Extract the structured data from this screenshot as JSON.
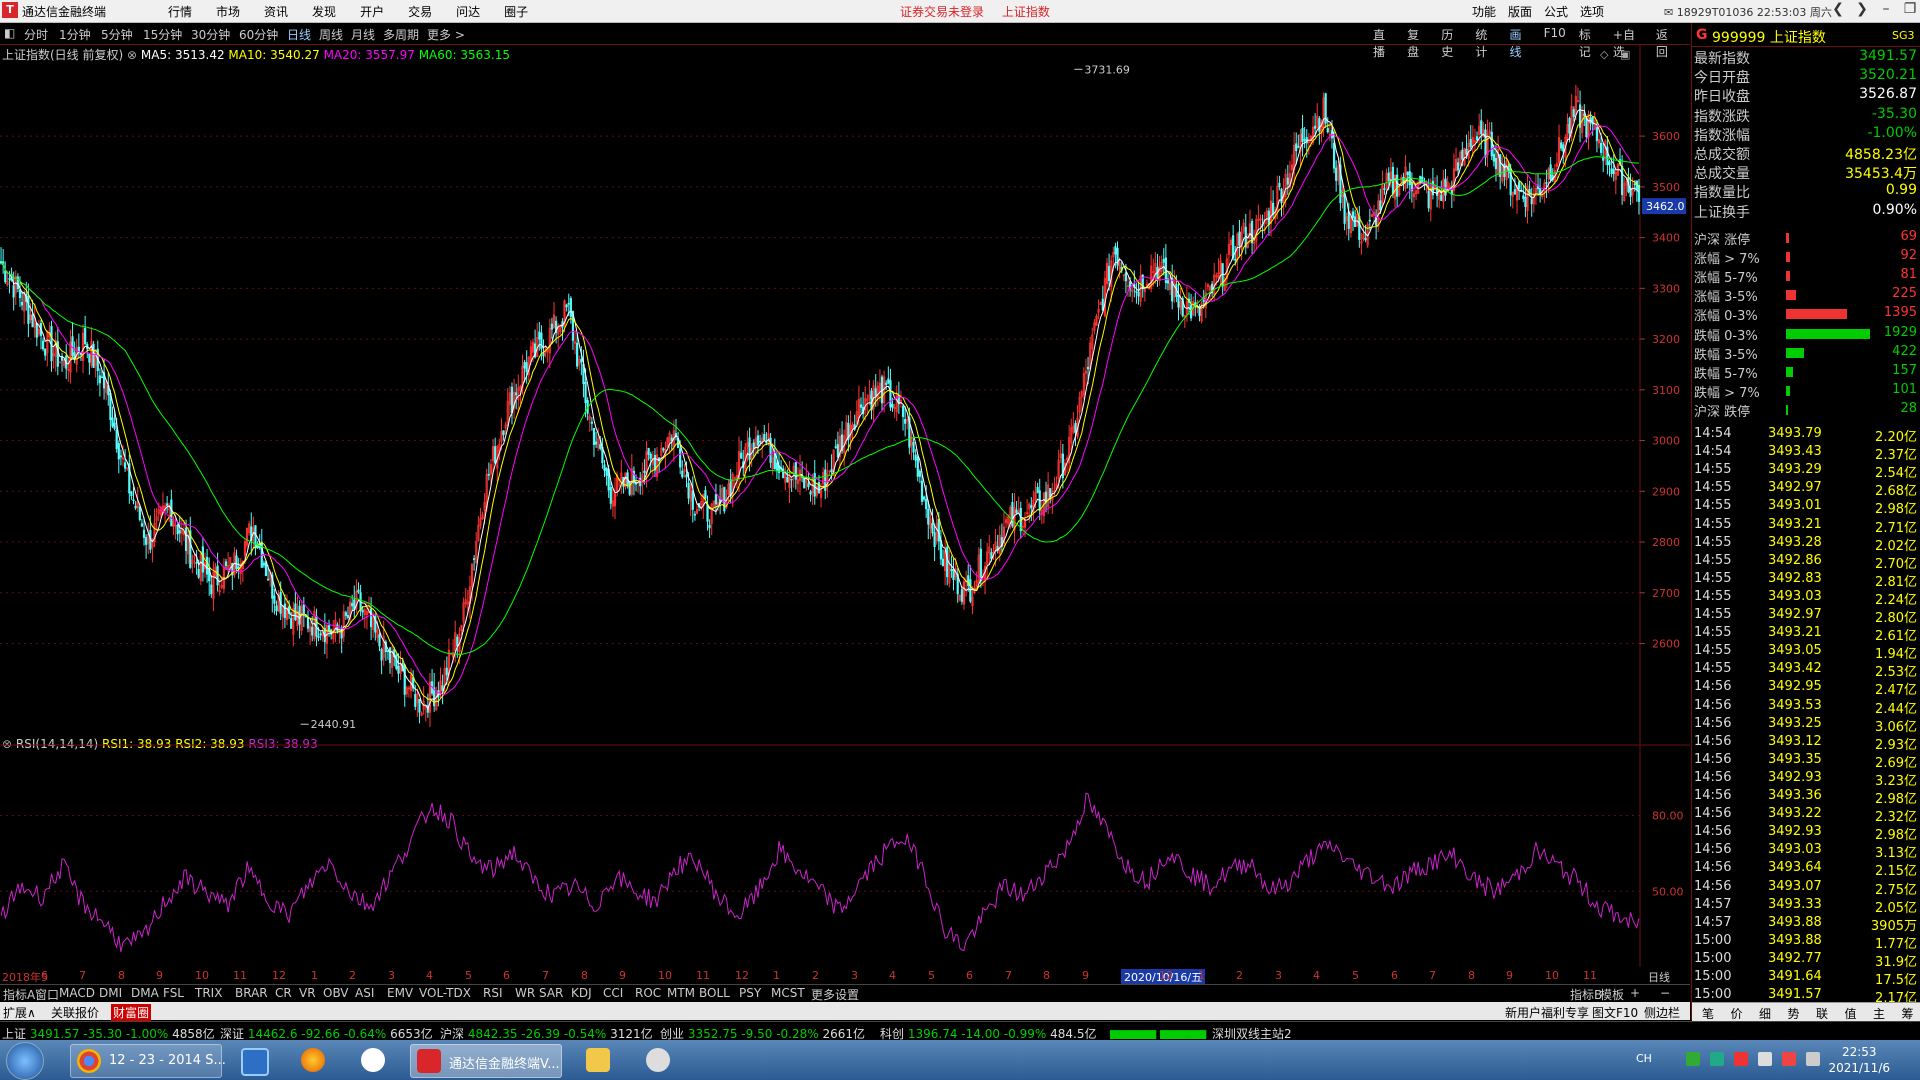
{
  "titlebar": {
    "app_title": "通达信金融终端",
    "logo": "T",
    "menu": [
      "行情",
      "市场",
      "资讯",
      "发现",
      "开户",
      "交易",
      "问达",
      "圈子"
    ],
    "center": [
      "证券交易未登录",
      "上证指数"
    ],
    "right_menu": [
      "功能",
      "版面",
      "公式",
      "选项"
    ],
    "account": "18929T01036 22:53:03 周六",
    "icons": [
      "mail-icon",
      "back-icon",
      "forward-icon",
      "minimize-icon",
      "restore-icon",
      "close-icon"
    ]
  },
  "periods": [
    {
      "label": "分时",
      "active": false
    },
    {
      "label": "1分钟",
      "active": false
    },
    {
      "label": "5分钟",
      "active": false
    },
    {
      "label": "15分钟",
      "active": false
    },
    {
      "label": "30分钟",
      "active": false
    },
    {
      "label": "60分钟",
      "active": false
    },
    {
      "label": "日线",
      "active": true
    },
    {
      "label": "周线",
      "active": false
    },
    {
      "label": "月线",
      "active": false
    },
    {
      "label": "多周期",
      "active": false
    },
    {
      "label": "更多 >",
      "active": false
    }
  ],
  "tools": [
    {
      "label": "直播",
      "on": false
    },
    {
      "label": "复盘",
      "on": false
    },
    {
      "label": "历史",
      "on": false
    },
    {
      "label": "统计",
      "on": false
    },
    {
      "label": "画线",
      "on": true
    },
    {
      "label": "F10",
      "on": false
    },
    {
      "label": "标记",
      "on": false
    },
    {
      "label": "+自选",
      "on": false
    },
    {
      "label": "返回",
      "on": false
    }
  ],
  "main_legend": {
    "name": "上证指数(日线 前复权)",
    "ma5": "MA5: 3513.42",
    "ma10": "MA10: 3540.27",
    "ma20": "MA20: 3557.97",
    "ma60": "MA60: 3563.15"
  },
  "rsi_legend": {
    "name": "RSI(14,14,14)",
    "rsi1": "RSI1: 38.93",
    "rsi2": "RSI2: 38.93",
    "rsi3": "RSI3: 38.93"
  },
  "chart_data": [
    {
      "type": "candlestick",
      "title": "上证指数(日线 前复权)",
      "ylim": [
        2400,
        3750
      ],
      "y_ticks": [
        2600,
        2700,
        2800,
        2900,
        3000,
        3100,
        3200,
        3300,
        3400,
        3500,
        3600
      ],
      "current_price": 3462.0,
      "annotations": [
        {
          "label": "3731.69",
          "value": 3731.69,
          "kind": "high"
        },
        {
          "label": "2440.91",
          "value": 2440.91,
          "kind": "low"
        }
      ],
      "series_shape": [
        3350,
        3280,
        3200,
        3150,
        3200,
        3100,
        2920,
        2800,
        2870,
        2780,
        2720,
        2750,
        2830,
        2700,
        2650,
        2640,
        2620,
        2680,
        2600,
        2540,
        2480,
        2520,
        2650,
        2900,
        3050,
        3150,
        3200,
        3260,
        3050,
        2900,
        2920,
        2960,
        3020,
        2880,
        2850,
        2940,
        3020,
        2960,
        2920,
        2900,
        3000,
        3080,
        3100,
        3050,
        2880,
        2750,
        2700,
        2780,
        2840,
        2860,
        2900,
        3000,
        3200,
        3380,
        3300,
        3350,
        3280,
        3250,
        3320,
        3400,
        3420,
        3500,
        3600,
        3650,
        3450,
        3400,
        3500,
        3520,
        3480,
        3500,
        3600,
        3580,
        3500,
        3480,
        3550,
        3650,
        3600,
        3520,
        3490
      ],
      "ma_series_colors": {
        "ma5": "#ffffff",
        "ma10": "#ffff00",
        "ma20": "#ff00ff",
        "ma60": "#00ff00"
      }
    },
    {
      "type": "line",
      "title": "RSI(14,14,14)",
      "ylim": [
        20,
        100
      ],
      "y_ticks": [
        50,
        80
      ],
      "values": [
        40,
        52,
        48,
        60,
        45,
        38,
        28,
        32,
        46,
        55,
        50,
        44,
        58,
        48,
        40,
        52,
        62,
        50,
        44,
        56,
        70,
        84,
        78,
        62,
        58,
        66,
        54,
        48,
        52,
        44,
        56,
        50,
        46,
        60,
        62,
        48,
        40,
        50,
        66,
        58,
        50,
        42,
        54,
        64,
        72,
        60,
        36,
        28,
        40,
        52,
        48,
        58,
        66,
        86,
        74,
        60,
        54,
        66,
        58,
        52,
        58,
        62,
        50,
        54,
        64,
        68,
        60,
        56,
        52,
        58,
        62,
        64,
        54,
        50,
        56,
        66,
        60,
        54,
        44,
        40,
        36
      ]
    }
  ],
  "date_axis": [
    {
      "label": "2018年5",
      "hl": false
    },
    {
      "label": "6",
      "hl": false
    },
    {
      "label": "7",
      "hl": false
    },
    {
      "label": "8",
      "hl": false
    },
    {
      "label": "9",
      "hl": false
    },
    {
      "label": "10",
      "hl": false
    },
    {
      "label": "11",
      "hl": false
    },
    {
      "label": "12",
      "hl": false
    },
    {
      "label": "1",
      "hl": false
    },
    {
      "label": "2",
      "hl": false
    },
    {
      "label": "3",
      "hl": false
    },
    {
      "label": "4",
      "hl": false
    },
    {
      "label": "5",
      "hl": false
    },
    {
      "label": "6",
      "hl": false
    },
    {
      "label": "7",
      "hl": false
    },
    {
      "label": "8",
      "hl": false
    },
    {
      "label": "9",
      "hl": false
    },
    {
      "label": "10",
      "hl": false
    },
    {
      "label": "11",
      "hl": false
    },
    {
      "label": "12",
      "hl": false
    },
    {
      "label": "1",
      "hl": false
    },
    {
      "label": "2",
      "hl": false
    },
    {
      "label": "3",
      "hl": false
    },
    {
      "label": "4",
      "hl": false
    },
    {
      "label": "5",
      "hl": false
    },
    {
      "label": "6",
      "hl": false
    },
    {
      "label": "7",
      "hl": false
    },
    {
      "label": "8",
      "hl": false
    },
    {
      "label": "9",
      "hl": false
    },
    {
      "label": "2020/10/16/五",
      "hl": true
    },
    {
      "label": "12",
      "hl": false
    },
    {
      "label": "1",
      "hl": false
    },
    {
      "label": "2",
      "hl": false
    },
    {
      "label": "3",
      "hl": false
    },
    {
      "label": "4",
      "hl": false
    },
    {
      "label": "5",
      "hl": false
    },
    {
      "label": "6",
      "hl": false
    },
    {
      "label": "7",
      "hl": false
    },
    {
      "label": "8",
      "hl": false
    },
    {
      "label": "9",
      "hl": false
    },
    {
      "label": "10",
      "hl": false
    },
    {
      "label": "11",
      "hl": false
    }
  ],
  "date_axis_right": "日线",
  "indicator_tabs": [
    "指标A",
    "窗口",
    "MACD",
    "DMI",
    "DMA",
    "FSL",
    "TRIX",
    "BRAR",
    "CR",
    "VR",
    "OBV",
    "ASI",
    "EMV",
    "VOL-TDX",
    "RSI",
    "WR",
    "SAR",
    "KDJ",
    "CCI",
    "ROC",
    "MTM",
    "BOLL",
    "PSY",
    "MCST",
    "更多",
    "设置"
  ],
  "indicator_tabs_right": [
    "指标B",
    "模板",
    "+",
    "−"
  ],
  "sub_tabs": [
    {
      "label": "扩展∧",
      "red": false
    },
    {
      "label": "关联报价",
      "red": false
    },
    {
      "label": "财富圈",
      "red": true
    }
  ],
  "sub_tabs_right": [
    "新用户福利专享",
    "图文F10",
    "侧边栏 <"
  ],
  "ticker": [
    {
      "name": "上证",
      "price": "3491.57",
      "chg": "-35.30",
      "pct": "-1.00%",
      "amt": "4858亿"
    },
    {
      "name": "深证",
      "price": "14462.6",
      "chg": "-92.66",
      "pct": "-0.64%",
      "amt": "6653亿"
    },
    {
      "name": "沪深",
      "price": "4842.35",
      "chg": "-26.39",
      "pct": "-0.54%",
      "amt": "3121亿"
    },
    {
      "name": "创业",
      "price": "3352.75",
      "chg": "-9.50",
      "pct": "-0.28%",
      "amt": "2661亿"
    },
    {
      "name": "科创",
      "price": "1396.74",
      "chg": "-14.00",
      "pct": "-0.99%",
      "amt": "484.5亿"
    }
  ],
  "ticker_station": "深圳双线主站2",
  "right_panel": {
    "head_mark": "G",
    "head_code": "999999 上证指数",
    "head_sg": "SG3",
    "quotes": [
      {
        "label": "最新指数",
        "value": "3491.57",
        "color": "#00cc00"
      },
      {
        "label": "今日开盘",
        "value": "3520.21",
        "color": "#00cc00"
      },
      {
        "label": "昨日收盘",
        "value": "3526.87",
        "color": "#ffffff"
      },
      {
        "label": "指数涨跌",
        "value": "-35.30",
        "color": "#00cc00"
      },
      {
        "label": "指数涨幅",
        "value": "-1.00%",
        "color": "#00cc00"
      },
      {
        "label": "总成交额",
        "value": "4858.23亿",
        "color": "#ffff00"
      },
      {
        "label": "总成交量",
        "value": "35453.4万",
        "color": "#ffff00"
      },
      {
        "label": "指数量比",
        "value": "0.99",
        "color": "#ffff00"
      },
      {
        "label": "上证换手",
        "value": "0.90%",
        "color": "#ffffff"
      }
    ],
    "breadth_up": [
      {
        "label": "沪深 涨停",
        "value": "69",
        "count": 69
      },
      {
        "label": "涨幅 > 7%",
        "value": "92",
        "count": 92
      },
      {
        "label": "涨幅 5-7%",
        "value": "81",
        "count": 81
      },
      {
        "label": "涨幅 3-5%",
        "value": "225",
        "count": 225
      },
      {
        "label": "涨幅 0-3%",
        "value": "1395",
        "count": 1395
      }
    ],
    "breadth_down": [
      {
        "label": "跌幅 0-3%",
        "value": "1929",
        "count": 1929
      },
      {
        "label": "跌幅 3-5%",
        "value": "422",
        "count": 422
      },
      {
        "label": "跌幅 5-7%",
        "value": "157",
        "count": 157
      },
      {
        "label": "跌幅 > 7%",
        "value": "101",
        "count": 101
      },
      {
        "label": "沪深 跌停",
        "value": "28",
        "count": 28
      }
    ],
    "trades": [
      {
        "t": "14:54",
        "p": "3493.79",
        "v": "2.20亿"
      },
      {
        "t": "14:54",
        "p": "3493.43",
        "v": "2.37亿"
      },
      {
        "t": "14:55",
        "p": "3493.29",
        "v": "2.54亿"
      },
      {
        "t": "14:55",
        "p": "3492.97",
        "v": "2.68亿"
      },
      {
        "t": "14:55",
        "p": "3493.01",
        "v": "2.98亿"
      },
      {
        "t": "14:55",
        "p": "3493.21",
        "v": "2.71亿"
      },
      {
        "t": "14:55",
        "p": "3493.28",
        "v": "2.02亿"
      },
      {
        "t": "14:55",
        "p": "3492.86",
        "v": "2.70亿"
      },
      {
        "t": "14:55",
        "p": "3492.83",
        "v": "2.81亿"
      },
      {
        "t": "14:55",
        "p": "3493.03",
        "v": "2.24亿"
      },
      {
        "t": "14:55",
        "p": "3492.97",
        "v": "2.80亿"
      },
      {
        "t": "14:55",
        "p": "3493.21",
        "v": "2.61亿"
      },
      {
        "t": "14:55",
        "p": "3493.05",
        "v": "1.94亿"
      },
      {
        "t": "14:55",
        "p": "3493.42",
        "v": "2.53亿"
      },
      {
        "t": "14:56",
        "p": "3492.95",
        "v": "2.47亿"
      },
      {
        "t": "14:56",
        "p": "3493.53",
        "v": "2.44亿"
      },
      {
        "t": "14:56",
        "p": "3493.25",
        "v": "3.06亿"
      },
      {
        "t": "14:56",
        "p": "3493.12",
        "v": "2.93亿"
      },
      {
        "t": "14:56",
        "p": "3493.35",
        "v": "2.69亿"
      },
      {
        "t": "14:56",
        "p": "3492.93",
        "v": "3.23亿"
      },
      {
        "t": "14:56",
        "p": "3493.36",
        "v": "2.98亿"
      },
      {
        "t": "14:56",
        "p": "3493.22",
        "v": "2.32亿"
      },
      {
        "t": "14:56",
        "p": "3492.93",
        "v": "2.98亿"
      },
      {
        "t": "14:56",
        "p": "3493.03",
        "v": "3.13亿"
      },
      {
        "t": "14:56",
        "p": "3493.64",
        "v": "2.15亿"
      },
      {
        "t": "14:56",
        "p": "3493.07",
        "v": "2.75亿"
      },
      {
        "t": "14:57",
        "p": "3493.33",
        "v": "2.05亿"
      },
      {
        "t": "14:57",
        "p": "3493.88",
        "v": "3905万"
      },
      {
        "t": "15:00",
        "p": "3493.88",
        "v": "1.77亿"
      },
      {
        "t": "15:00",
        "p": "3492.77",
        "v": "31.9亿"
      },
      {
        "t": "15:00",
        "p": "3491.64",
        "v": "17.5亿"
      },
      {
        "t": "15:00",
        "p": "3491.57",
        "v": "2.17亿"
      }
    ],
    "bottom_tabs": [
      "笔",
      "价",
      "细",
      "势",
      "联",
      "值",
      "主",
      "筹"
    ]
  },
  "taskbar": {
    "chrome_label": "12 - 23 - 2014 S...",
    "tdx_label": "通达信金融终端V...",
    "clock_time": "22:53",
    "clock_date": "2021/11/6",
    "tray_lang": "CH"
  },
  "colors": {
    "up": "#ff3333",
    "down": "#00cc00",
    "accent": "#d8262b",
    "grid": "#6b1010",
    "rsi": "#cc22cc"
  }
}
